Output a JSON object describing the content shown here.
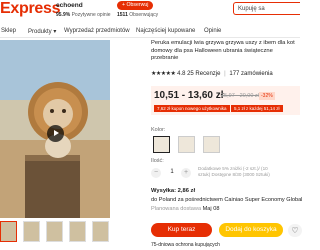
{
  "header": {
    "logo": "Express",
    "store_name": "echoend",
    "positive_value": "95.9%",
    "positive_label": "Pozytywne opinie",
    "follow_label": "+ Obserwuj",
    "followers_count": "1511",
    "followers_label": "Obserwujący",
    "search_value": "Kupuję sa"
  },
  "nav": {
    "items": [
      "Sklep",
      "Produkty",
      "Wyprzedaż przedmiotów",
      "Najczęściej kupowane",
      "Opinie"
    ],
    "dropdown_symbol": "▾"
  },
  "product": {
    "title": "Peruka emulacji lwia grzywa grzywa uszy z ibem dla kot domowy dla psa Halloween ubrania świąteczne przebranie",
    "stars": "★★★★★",
    "rating": "4.8",
    "reviews": "25 Recenzje",
    "orders": "177 zamówienia",
    "price": "10,51 - 13,60 zł",
    "old_price": "15,97 - 20,00 zł",
    "discount": "-32%",
    "coupons": [
      "7,62 zł kupon nowego użytkownika",
      "5,1 zł z każdej 51,14 zł"
    ],
    "color_label": "Kolor:",
    "size_label": "Rozmiar:",
    "quantity_label": "Ilość:",
    "quantity_value": "1",
    "quantity_minus": "−",
    "quantity_plus": "+",
    "stock_text": "Dodatkowe 5% zniżki (-2 szt.)/ (10 sztuk) Dostępne 8/30 (3000 Sztuki)",
    "shipping_label": "Wysyłka:",
    "shipping_price": "2,86 zł",
    "shipping_route": "do Poland za pośrednictwem Cainiao Super Economy Global",
    "delivery_estimate": "Planowana dostawa",
    "delivery_date": "Maj 08",
    "buy_now": "Kup teraz",
    "add_to_cart": "Dodaj do koszyka",
    "wishlist_symbol": "♡",
    "guarantee": "75-dniowa ochrona kupujących"
  },
  "colors": {
    "accent": "#e62e04",
    "cart": "#ffc501",
    "price_bg": "#fff1ec"
  }
}
